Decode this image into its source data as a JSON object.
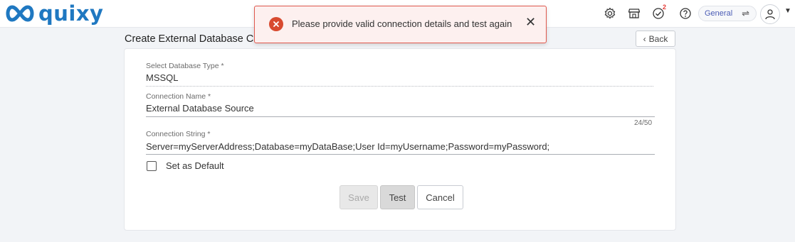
{
  "app": {
    "logo_text": "quixy",
    "brand_color": "#1f78c1"
  },
  "topbar": {
    "icons": [
      "settings-icon",
      "store-icon",
      "tasks-check-icon",
      "help-icon"
    ],
    "tasks_badge": "2",
    "workspace": {
      "label": "General",
      "swap_glyph": "⇌"
    },
    "profile_caret": "▼"
  },
  "toast": {
    "message": "Please provide valid connection details and test again",
    "close_glyph": "✕",
    "error_color": "#d84a2f"
  },
  "page": {
    "title": "Create External Database C",
    "back_label": "Back",
    "back_glyph": "‹"
  },
  "form": {
    "db_type": {
      "label": "Select Database Type *",
      "value": "MSSQL"
    },
    "connection_name": {
      "label": "Connection Name *",
      "value": "External Database Source",
      "counter": "24/50"
    },
    "connection_string": {
      "label": "Connection String *",
      "value": "Server=myServerAddress;Database=myDataBase;User Id=myUsername;Password=myPassword;"
    },
    "default_checkbox": {
      "label": "Set as Default",
      "checked": false
    },
    "buttons": {
      "save": "Save",
      "test": "Test",
      "cancel": "Cancel"
    }
  }
}
